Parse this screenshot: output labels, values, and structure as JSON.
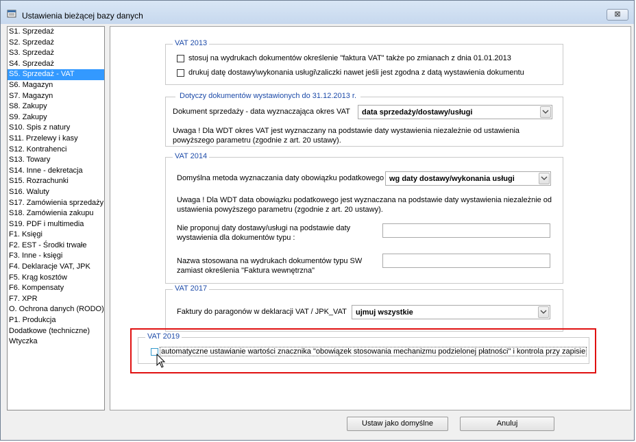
{
  "window": {
    "title": "Ustawienia bieżącej bazy danych",
    "title_icon": "database-settings-icon",
    "close_glyph": "⊠"
  },
  "sidebar": {
    "items": [
      {
        "label": "S1. Sprzedaż"
      },
      {
        "label": "S2. Sprzedaż"
      },
      {
        "label": "S3. Sprzedaż"
      },
      {
        "label": "S4. Sprzedaż"
      },
      {
        "label": "S5. Sprzedaż - VAT",
        "selected": true
      },
      {
        "label": "S6. Magazyn"
      },
      {
        "label": "S7. Magazyn"
      },
      {
        "label": "S8. Zakupy"
      },
      {
        "label": "S9. Zakupy"
      },
      {
        "label": "S10. Spis z natury"
      },
      {
        "label": "S11. Przelewy i kasy"
      },
      {
        "label": "S12. Kontrahenci"
      },
      {
        "label": "S13. Towary"
      },
      {
        "label": "S14. Inne - dekretacja"
      },
      {
        "label": "S15. Rozrachunki"
      },
      {
        "label": "S16. Waluty"
      },
      {
        "label": "S17. Zamówienia sprzedaży"
      },
      {
        "label": "S18. Zamówienia zakupu"
      },
      {
        "label": "S19. PDF i multimedia"
      },
      {
        "label": "F1. Księgi"
      },
      {
        "label": "F2. EST - Środki trwałe"
      },
      {
        "label": "F3. Inne - księgi"
      },
      {
        "label": "F4. Deklaracje VAT, JPK"
      },
      {
        "label": "F5. Krąg kosztów"
      },
      {
        "label": "F6. Kompensaty"
      },
      {
        "label": "F7. XPR"
      },
      {
        "label": "O. Ochrona danych (RODO)"
      },
      {
        "label": "P1. Produkcja"
      },
      {
        "label": "Dodatkowe (techniczne)"
      },
      {
        "label": "Wtyczka"
      }
    ]
  },
  "vat2013": {
    "legend": "VAT 2013",
    "cb1_label": "stosuj na wydrukach dokumentów określenie \"faktura VAT\" także po zmianach z dnia 01.01.2013",
    "cb2_label": "drukuj datę dostawy\\wykonania usługi\\zaliczki nawet jeśli jest zgodna z datą wystawienia dokumentu"
  },
  "docs2013": {
    "legend": "Dotyczy dokumentów wystawionych do 31.12.2013 r.",
    "field_label": "Dokument sprzedaży - data wyznaczająca okres VAT",
    "combo_value": "data sprzedaży/dostawy/usługi",
    "note": "Uwaga ! Dla WDT okres VAT jest wyznaczany na podstawie daty wystawienia niezależnie od ustawienia powyższego parametru (zgodnie z art. 20 ustawy)."
  },
  "vat2014": {
    "legend": "VAT 2014",
    "method_label": "Domyślna metoda wyznaczania daty obowiązku podatkowego",
    "method_value": "wg daty dostawy/wykonania usługi",
    "note": "Uwaga ! Dla WDT data obowiązku podatkowego jest wyznaczana na podstawie daty wystawienia niezależnie od ustawienia powyższego parametru (zgodnie z art. 20 ustawy).",
    "no_propose_label": "Nie proponuj daty dostawy/usługi na podstawie daty wystawienia dla dokumentów typu :",
    "no_propose_value": "",
    "sw_label": "Nazwa stosowana na wydrukach dokumentów typu SW zamiast określenia \"Faktura wewnętrzna\"",
    "sw_value": ""
  },
  "vat2017": {
    "legend": "VAT 2017",
    "label": "Faktury do paragonów w deklaracji VAT / JPK_VAT",
    "value": "ujmuj wszystkie"
  },
  "vat2019": {
    "legend": "VAT 2019",
    "cb_label": "automatyczne ustawianie wartości znacznika \"obowiązek stosowania mechanizmu podzielonej płatności\" i kontrola przy zapisie"
  },
  "buttons": {
    "default_label": "Ustaw jako domyślne",
    "cancel_label": "Anuluj"
  },
  "colors": {
    "selection": "#3399ff",
    "legend": "#1c4aa8",
    "highlight": "#e01010"
  }
}
